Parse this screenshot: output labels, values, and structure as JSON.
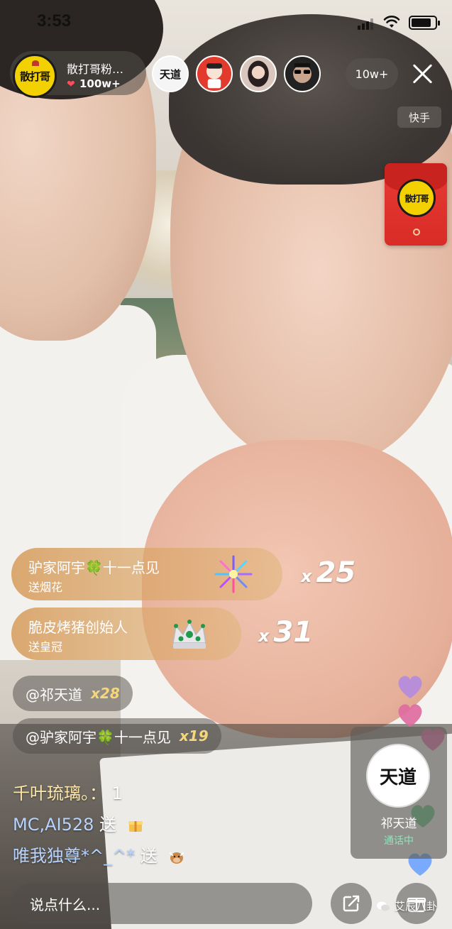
{
  "status_bar": {
    "time": "3:53",
    "battery_level": 0.85
  },
  "host": {
    "logo_text": "散打哥",
    "name": "散打哥粉…",
    "likes": "100w+"
  },
  "viewers": {
    "avatars": [
      {
        "icon": "dao-avatar",
        "text": "天道"
      },
      {
        "icon": "cartoon-avatar",
        "text": ""
      },
      {
        "icon": "woman-avatar",
        "text": ""
      },
      {
        "icon": "sunglasses-avatar",
        "text": ""
      }
    ],
    "count": "10w+"
  },
  "platform_tag": "快手",
  "red_envelope": {
    "logo_text": "散打哥"
  },
  "gifts": [
    {
      "sender": "驴家阿宇🍀十一点见",
      "desc": "送烟花",
      "icon": "fireworks-icon",
      "count_prefix": "x",
      "count": "25"
    },
    {
      "sender": "脆皮烤猪创始人",
      "desc": "送皇冠",
      "icon": "crown-icon",
      "count_prefix": "x",
      "count": "31"
    }
  ],
  "comment_bubbles": [
    {
      "text": "@祁天道",
      "combo": "x28"
    },
    {
      "text": "@驴家阿宇🍀十一点见",
      "combo": "x19"
    }
  ],
  "chat": [
    {
      "user": "千叶琉璃。：",
      "text": "1"
    },
    {
      "user": "MC,AI528",
      "text": "送"
    },
    {
      "user": "唯我独尊*^_^*",
      "text": "送"
    }
  ],
  "call_panel": {
    "name": "祁天道",
    "status": "通话中",
    "avatar_text": "天道"
  },
  "bottom_bar": {
    "input_placeholder": "说点什么..."
  },
  "watermark": "艾辰八卦",
  "colors": {
    "gift_gradient": "#d69b5a",
    "combo": "#f5d77a",
    "call_status": "#8be6b8",
    "heart": "#ff4d5e",
    "logo_yellow": "#f3d000",
    "envelope_red": "#e73a34"
  }
}
